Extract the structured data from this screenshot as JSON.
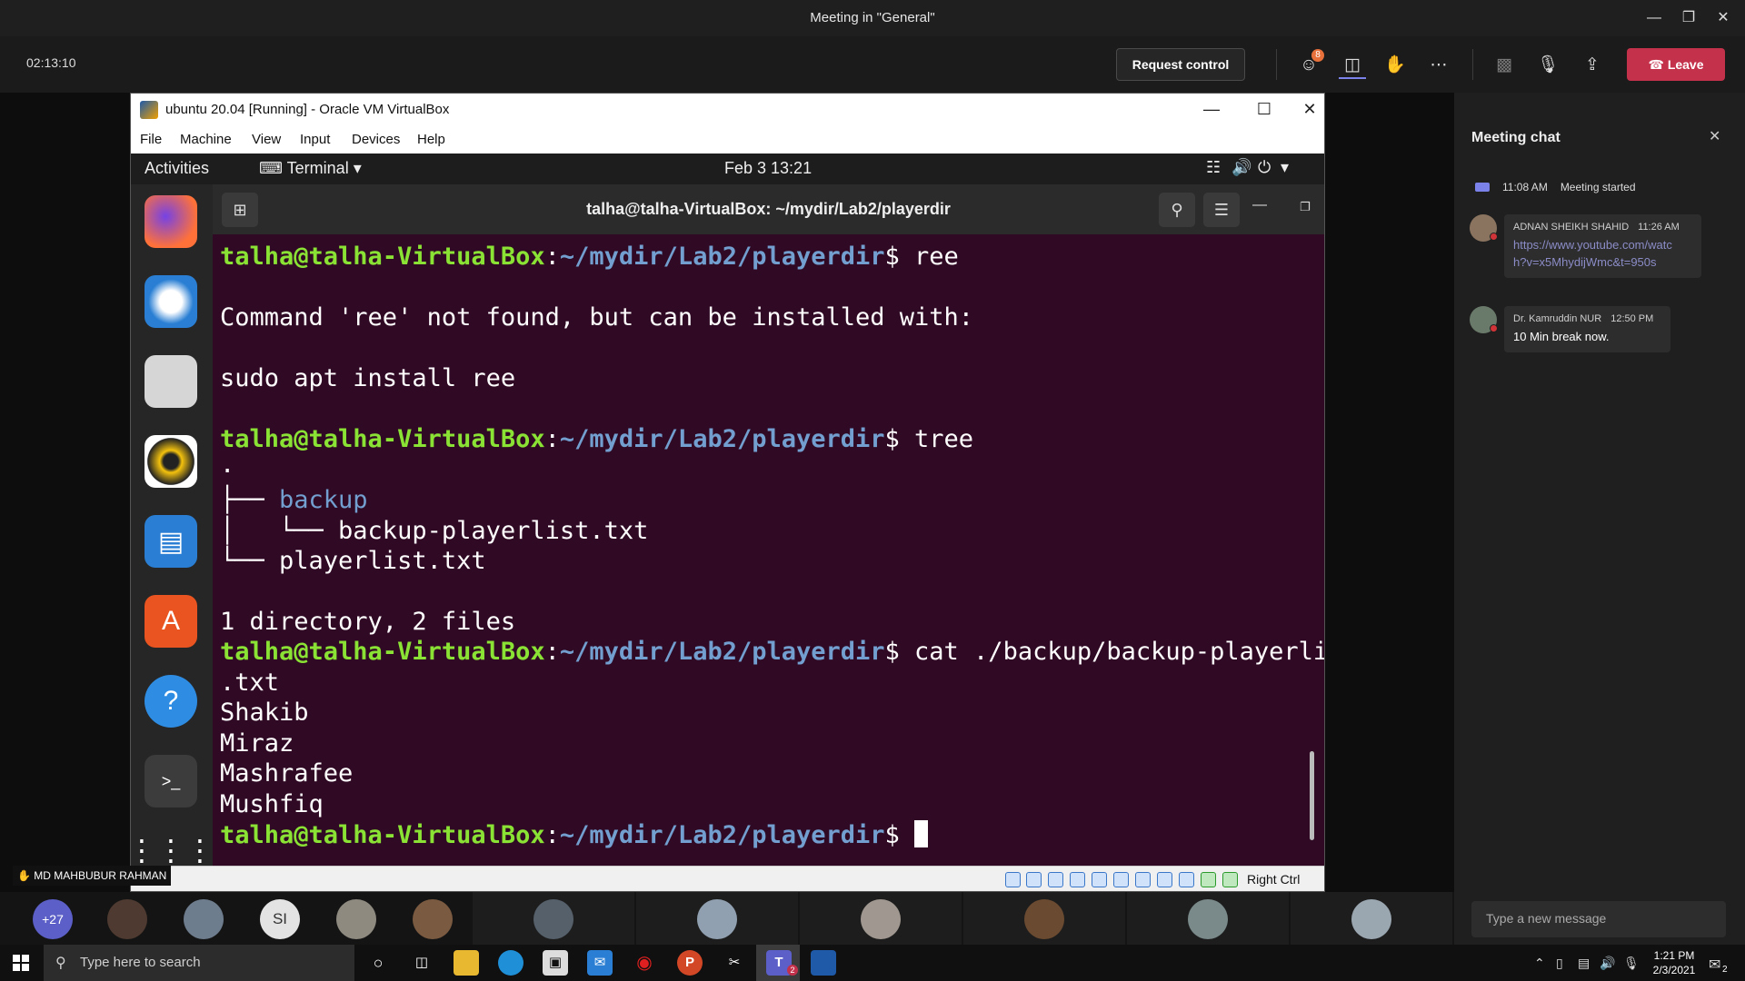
{
  "teams": {
    "window_title": "Meeting in \"General\"",
    "timer": "02:13:10",
    "request_control_label": "Request control",
    "participants_badge": "8",
    "leave_label": "Leave",
    "toolbar_icons": [
      "participants-icon",
      "chat-icon",
      "raise-hand-icon",
      "more-options-icon",
      "camera-off-icon",
      "mic-off-icon",
      "share-screen-icon"
    ]
  },
  "vbox": {
    "title": "ubuntu 20.04 [Running] - Oracle VM VirtualBox",
    "menu": [
      "File",
      "Machine",
      "View",
      "Input",
      "Devices",
      "Help"
    ],
    "host_key": "Right Ctrl"
  },
  "gnome": {
    "activities": "Activities",
    "app_menu": "Terminal",
    "clock": "Feb 3  13:21"
  },
  "terminal": {
    "title": "talha@talha-VirtualBox: ~/mydir/Lab2/playerdir",
    "prompt_user": "talha@talha-VirtualBox",
    "prompt_sep": ":",
    "prompt_path": "~/mydir/Lab2/playerdir",
    "prompt_end": "$ ",
    "cmd1": "ree",
    "out1": "Command 'ree' not found, but can be installed with:",
    "out2": "sudo apt install ree",
    "cmd2": "tree",
    "tree_root": ".",
    "tree_line1_prefix": "├── ",
    "tree_line1_dir": "backup",
    "tree_line2": "│   └── backup-playerlist.txt",
    "tree_line3": "└── playerlist.txt",
    "summary": "1 directory, 2 files",
    "cmd3": "cat ./backup/backup-playerlist",
    "cmd3_wrap": ".txt",
    "players": [
      "Shakib",
      "Miraz",
      "Mashrafee",
      "Mushfiq"
    ]
  },
  "raised_hand_name": "MD MAHBUBUR RAHMAN",
  "chat": {
    "title": "Meeting chat",
    "system_time": "11:08 AM",
    "system_text": "Meeting started",
    "messages": [
      {
        "author": "ADNAN SHEIKH SHAHID",
        "time": "11:26 AM",
        "text": "https://www.youtube.com/watch?v=x5MhydijWmc&t=950s",
        "line1": "https://www.youtube.com/watc",
        "line2": "h?v=x5MhydijWmc&t=950s"
      },
      {
        "author": "Dr. Kamruddin NUR",
        "time": "12:50 PM",
        "text": "10 Min break now."
      }
    ],
    "input_placeholder": "Type a new message"
  },
  "strip": {
    "overflow_count": "+27",
    "initials": "SI"
  },
  "taskbar": {
    "search_placeholder": "Type here to search",
    "time": "1:21 PM",
    "date": "2/3/2021",
    "notification_count": "2",
    "teams_badge": "2"
  },
  "colors": {
    "terminal_bg": "#300a24",
    "prompt_user": "#8ae234",
    "prompt_path": "#729fcf",
    "leave_red": "#c4314b",
    "ubuntu_orange": "#e95420"
  }
}
